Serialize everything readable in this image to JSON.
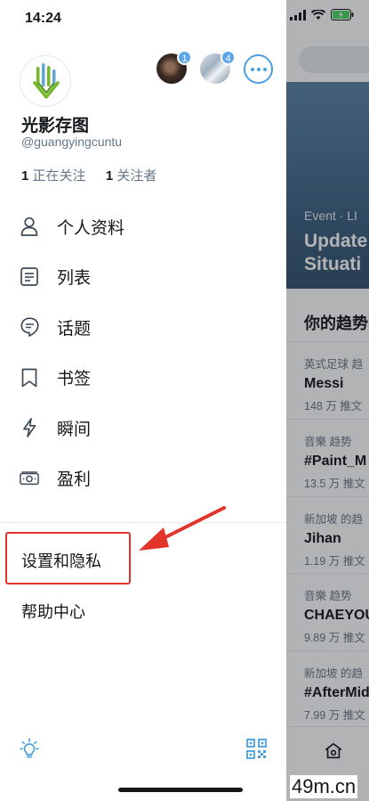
{
  "status_bar": {
    "time": "14:24"
  },
  "profile": {
    "name": "光影存图",
    "handle": "@guangyingcuntu",
    "following_count": "1",
    "following_label": "正在关注",
    "followers_count": "1",
    "followers_label": "关注者"
  },
  "accounts": [
    {
      "badge": "1"
    },
    {
      "badge": "4"
    }
  ],
  "menu": [
    {
      "label": "个人资料",
      "icon": "person-icon"
    },
    {
      "label": "列表",
      "icon": "list-icon"
    },
    {
      "label": "话题",
      "icon": "topics-icon"
    },
    {
      "label": "书签",
      "icon": "bookmark-icon"
    },
    {
      "label": "瞬间",
      "icon": "lightning-icon"
    },
    {
      "label": "盈利",
      "icon": "monetization-icon"
    }
  ],
  "secondary_menu": {
    "settings": "设置和隐私",
    "help": "帮助中心"
  },
  "timeline": {
    "hero_meta": "Event · LI",
    "hero_title_line1": "Update",
    "hero_title_line2": "Situati",
    "trends_title": "你的趋势",
    "trends": [
      {
        "context": "英式足球 趋",
        "name": "Messi",
        "count": "148 万 推文"
      },
      {
        "context": "音樂 趋势",
        "name": "#Paint_M",
        "count": "13.5 万 推文"
      },
      {
        "context": "新加坡 的趋",
        "name": "Jihan",
        "count": "1.19 万 推文"
      },
      {
        "context": "音樂 趋势",
        "name": "CHAEYOU",
        "count": "9.89 万 推文"
      },
      {
        "context": "新加坡 的趋",
        "name": "#AfterMid",
        "count": "7.99 万 推文"
      }
    ]
  },
  "watermark": "49m.cn",
  "colors": {
    "accent": "#4a9fe0",
    "highlight": "#e2342b",
    "text": "#14171a",
    "muted": "#657786"
  }
}
